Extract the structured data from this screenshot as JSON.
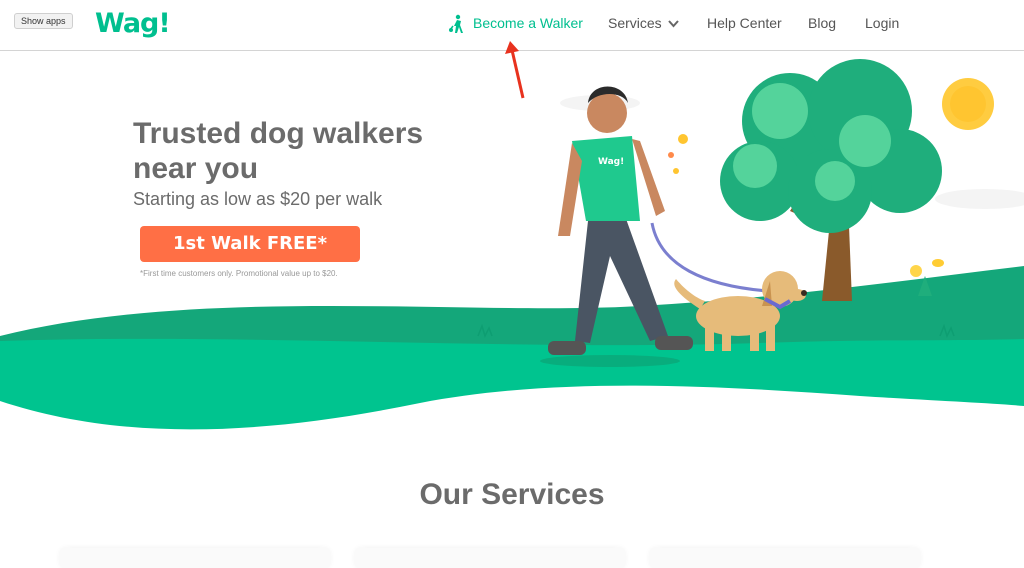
{
  "browser": {
    "show_apps_label": "Show apps"
  },
  "header": {
    "logo": "Wag!",
    "nav": {
      "become_walker": "Become a Walker",
      "services": "Services",
      "help_center": "Help Center",
      "blog": "Blog",
      "login": "Login"
    }
  },
  "hero": {
    "title": "Trusted dog walkers near you",
    "subtitle": "Starting as low as $20 per walk",
    "cta": "1st Walk FREE*",
    "disclaimer": "*First time customers only. Promotional value up to $20.",
    "shirt_logo": "Wag!"
  },
  "services": {
    "title": "Our Services"
  },
  "colors": {
    "brand": "#00bf8f",
    "cta": "#ff6f45",
    "text": "#6b6b6b",
    "annotation": "#e8321e"
  }
}
